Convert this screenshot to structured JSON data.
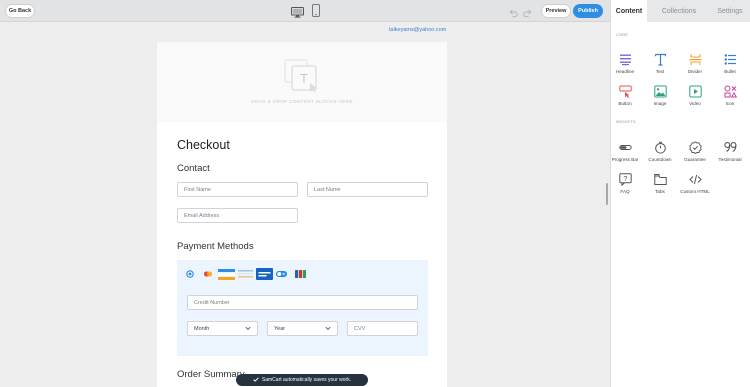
{
  "toolbar": {
    "go_back": "Go Back",
    "preview": "Preview",
    "publish": "Publish",
    "desktop_icon": "desktop-icon",
    "mobile_icon": "mobile-icon",
    "undo_icon": "undo-icon",
    "redo_icon": "redo-icon"
  },
  "canvas": {
    "email": "talkeyams@yahoo.com",
    "dropzone_text": "DRAG & DROP CONTENT BLOCKS HERE",
    "checkout_title": "Checkout",
    "contact_title": "Contact",
    "first_name": "First Name",
    "last_name": "Last Name",
    "email_address": "Email Address",
    "payment_title": "Payment Methods",
    "credit_number": "Credit Number",
    "month": "Month",
    "year": "Year",
    "cvv": "CVV",
    "order_summary": "Order Summary",
    "toast": "SamCart automatically saves your work."
  },
  "panel": {
    "tabs": [
      "Content",
      "Collections",
      "Settings"
    ],
    "active_tab": "Content",
    "core_label": "CORE",
    "widgets_label": "WIDGETS",
    "core": [
      {
        "label": "Headline",
        "icon": "headline-icon"
      },
      {
        "label": "Text",
        "icon": "text-icon"
      },
      {
        "label": "Divider",
        "icon": "divider-icon"
      },
      {
        "label": "Bullet",
        "icon": "bullet-icon"
      },
      {
        "label": "Button",
        "icon": "button-icon"
      },
      {
        "label": "Image",
        "icon": "image-icon"
      },
      {
        "label": "Video",
        "icon": "video-icon"
      },
      {
        "label": "Icon",
        "icon": "icon-icon"
      }
    ],
    "widgets": [
      {
        "label": "Progress Bar",
        "icon": "progress-bar-icon"
      },
      {
        "label": "Countdown",
        "icon": "countdown-icon"
      },
      {
        "label": "Guarantee",
        "icon": "guarantee-icon"
      },
      {
        "label": "Testimonial",
        "icon": "testimonial-icon"
      },
      {
        "label": "FAQ",
        "icon": "faq-icon"
      },
      {
        "label": "Tabs",
        "icon": "tabs-icon"
      },
      {
        "label": "Custom HTML",
        "icon": "custom-html-icon"
      }
    ]
  },
  "colors": {
    "accent": "#2f8de4",
    "toast_bg": "#26323f",
    "payment_bg": "#ecf5fd"
  }
}
